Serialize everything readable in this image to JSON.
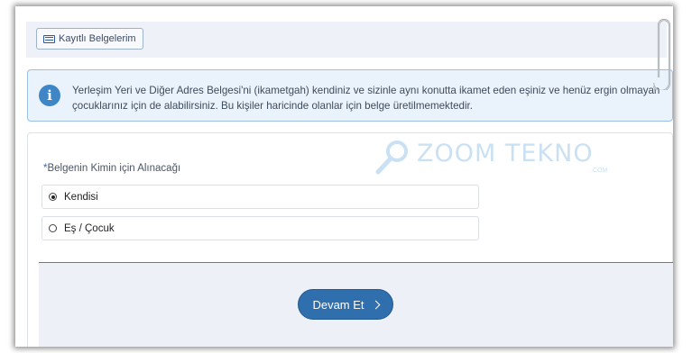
{
  "toolbar": {
    "saved_docs_label": "Kayıtlı Belgelerim"
  },
  "info": {
    "text": "Yerleşim Yeri ve Diğer Adres Belgesi'ni (ikametgah) kendiniz ve sizinle aynı konutta ikamet eden eşiniz ve henüz ergin olmayan çocuklarınız için de alabilirsiniz. Bu kişiler haricinde olanlar için belge üretilmemektedir."
  },
  "form": {
    "required_mark": "*",
    "label": "Belgenin Kimin için Alınacağı",
    "options": [
      {
        "label": "Kendisi",
        "selected": true
      },
      {
        "label": "Eş / Çocuk",
        "selected": false
      }
    ]
  },
  "actions": {
    "continue_label": "Devam Et"
  },
  "watermark": {
    "brand": "ZOOM TEKNO",
    "suffix": ".COM"
  },
  "colors": {
    "accent": "#2f6fad",
    "info_bg": "#eaf3fb",
    "panel_bg": "#edf1f7"
  }
}
